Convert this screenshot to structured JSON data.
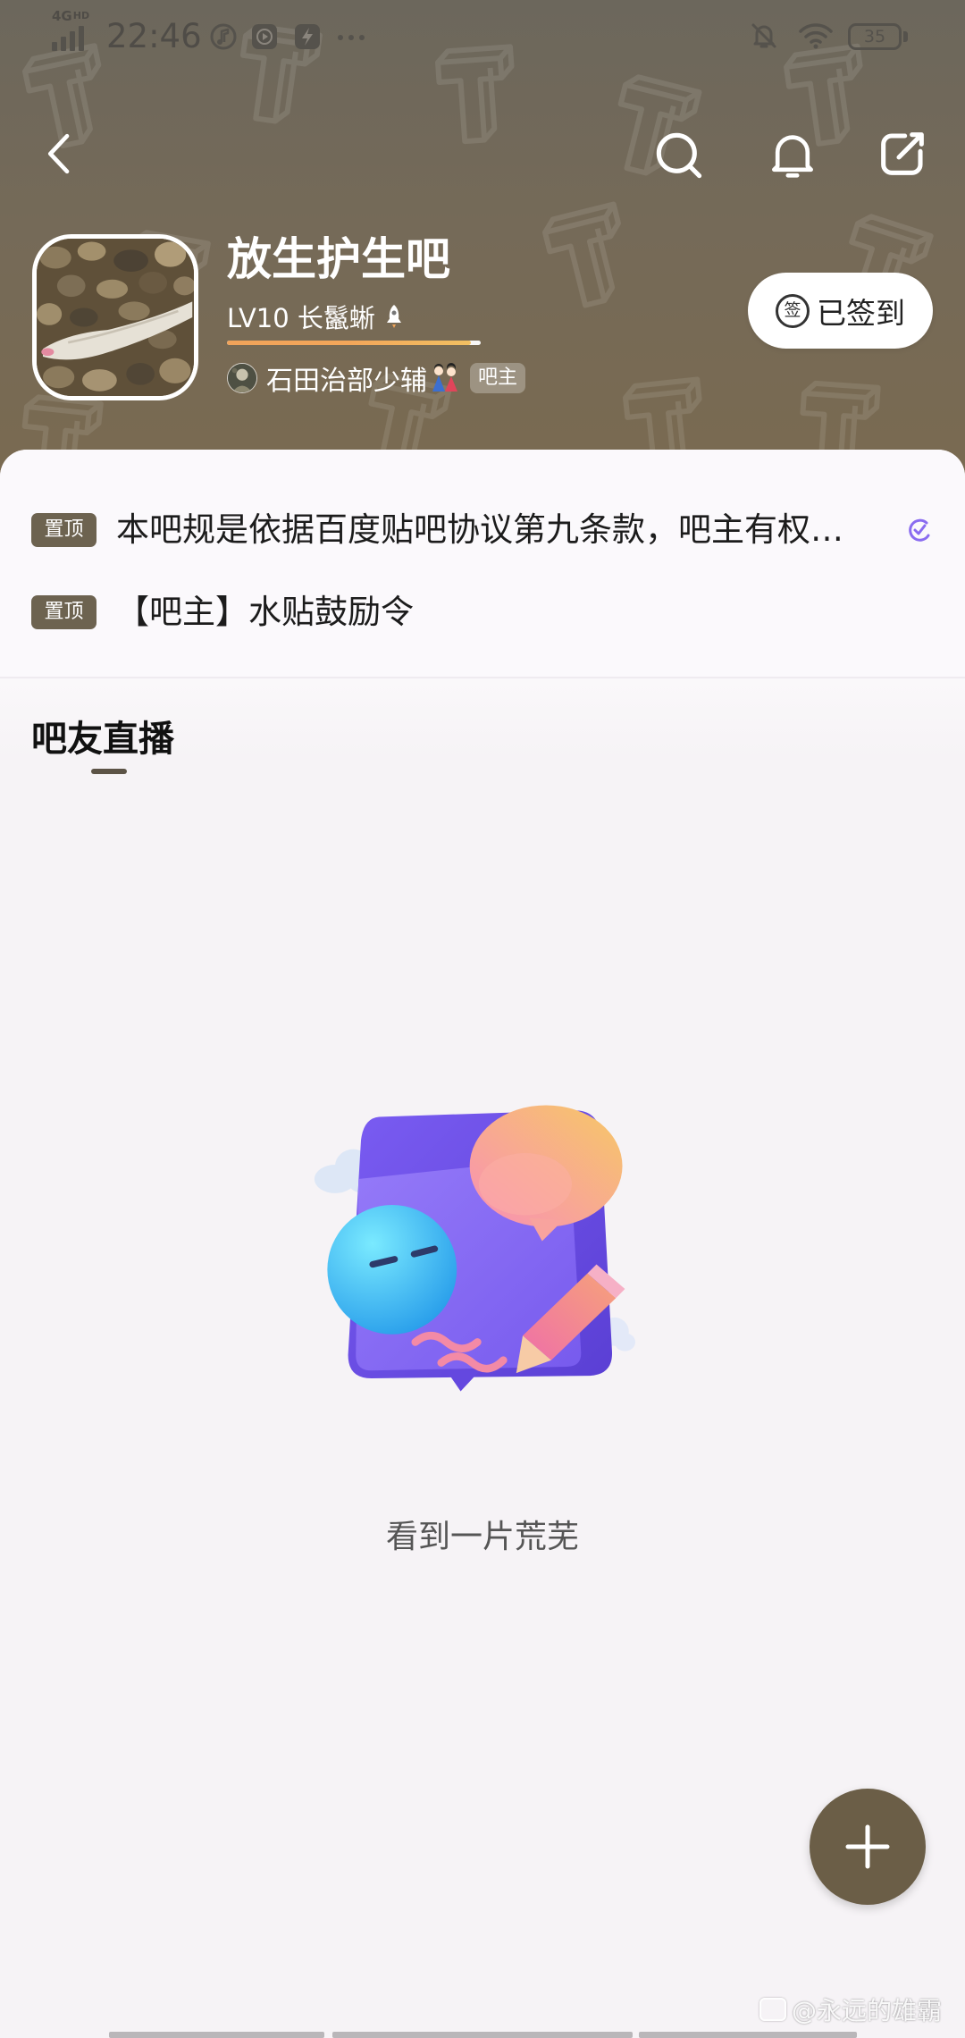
{
  "status_bar": {
    "network_type": "4G",
    "network_hd": "HD",
    "time": "22:46",
    "battery_level": "35",
    "icons": [
      "signal-icon",
      "music-icon",
      "play-icon",
      "app-icon",
      "more-icon",
      "mute-bell-icon",
      "wifi-icon",
      "battery-icon"
    ]
  },
  "nav": {
    "icons": [
      "back-icon",
      "search-icon",
      "bell-icon",
      "compose-icon"
    ]
  },
  "forum": {
    "name": "放生护生吧",
    "level": "LV10 长鬣蜥",
    "level_progress": 0.96,
    "moderator": {
      "name": "石田治部少辅",
      "badge": "吧主"
    },
    "checkin": {
      "icon_text": "签",
      "label": "已签到"
    }
  },
  "pinned": [
    {
      "badge": "置顶",
      "title": "本吧规是依据百度贴吧协议第九条款，吧主有权…"
    },
    {
      "badge": "置顶",
      "title": "【吧主】水贴鼓励令"
    }
  ],
  "section": {
    "title": "吧友直播"
  },
  "empty_state": {
    "message": "看到一片荒芜"
  },
  "fab": {
    "icon": "plus-icon"
  },
  "watermark": {
    "text": "@永远的雄霸"
  },
  "colors": {
    "header_bg": "#7a6a50",
    "accent": "#6b5e47",
    "badge_bg": "#6d6350",
    "progress": "#f3a65a"
  }
}
